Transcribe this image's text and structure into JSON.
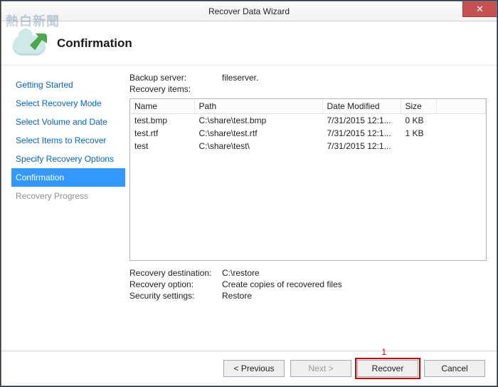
{
  "window": {
    "title": "Recover Data Wizard",
    "heading": "Confirmation"
  },
  "nav": {
    "items": [
      {
        "label": "Getting Started",
        "state": "link"
      },
      {
        "label": "Select Recovery Mode",
        "state": "link"
      },
      {
        "label": "Select Volume and Date",
        "state": "link"
      },
      {
        "label": "Select Items to Recover",
        "state": "link"
      },
      {
        "label": "Specify Recovery Options",
        "state": "link"
      },
      {
        "label": "Confirmation",
        "state": "active"
      },
      {
        "label": "Recovery Progress",
        "state": "disabled"
      }
    ]
  },
  "info": {
    "backup_server_label": "Backup server:",
    "backup_server_value": "fileserver.",
    "recovery_items_label": "Recovery items:"
  },
  "table": {
    "columns": {
      "name": "Name",
      "path": "Path",
      "date": "Date Modified",
      "size": "Size"
    },
    "rows": [
      {
        "name": "test.bmp",
        "path": "C:\\share\\test.bmp",
        "date": "7/31/2015 12:1...",
        "size": "0 KB"
      },
      {
        "name": "test.rtf",
        "path": "C:\\share\\test.rtf",
        "date": "7/31/2015 12:1...",
        "size": "1 KB"
      },
      {
        "name": "test",
        "path": "C:\\share\\test\\",
        "date": "7/31/2015 12:1...",
        "size": ""
      }
    ]
  },
  "summary": {
    "dest_label": "Recovery destination:",
    "dest_value": "C:\\restore",
    "option_label": "Recovery option:",
    "option_value": "Create copies of recovered files",
    "security_label": "Security settings:",
    "security_value": "Restore"
  },
  "buttons": {
    "previous": "< Previous",
    "next": "Next >",
    "recover": "Recover",
    "cancel": "Cancel"
  },
  "annotation": {
    "number": "1"
  },
  "watermark": "熱白新聞"
}
